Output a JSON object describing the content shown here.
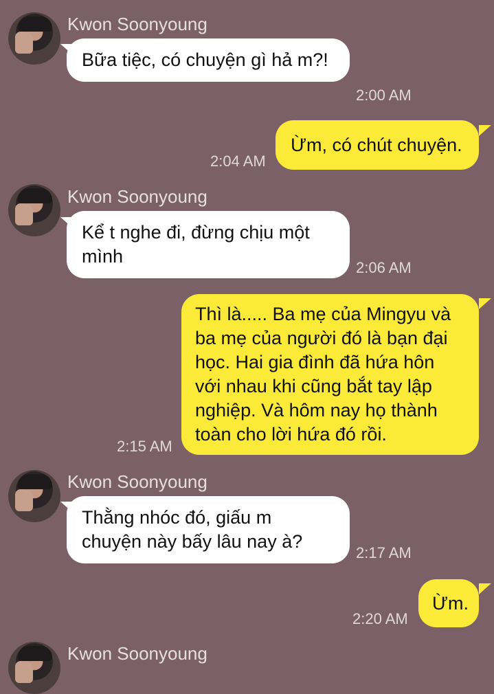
{
  "messages": [
    {
      "sender": "Kwon Soonyoung",
      "text": "Bữa tiệc, có chuyện gì hả m?!",
      "time": "2:00 AM"
    },
    {
      "text": "Ừm, có chút chuyện.",
      "time": "2:04 AM"
    },
    {
      "sender": "Kwon Soonyoung",
      "text": "Kể t nghe đi, đừng chịu một mình",
      "time": "2:06 AM"
    },
    {
      "text": "Thì là..... Ba mẹ của Mingyu và ba mẹ của người đó là bạn đại học. Hai gia đình đã hứa hôn với nhau khi cũng bắt tay lập nghiệp. Và hôm nay họ thành toàn cho lời hứa đó rồi.",
      "time": "2:15 AM"
    },
    {
      "sender": "Kwon Soonyoung",
      "text": "Thằng nhóc đó, giấu m chuyện này bấy lâu nay à?",
      "time": "2:17 AM"
    },
    {
      "text": "Ừm.",
      "time": "2:20 AM"
    },
    {
      "sender": "Kwon Soonyoung"
    }
  ],
  "colors": {
    "background": "#7b6068",
    "incoming": "#ffffff",
    "outgoing": "#fbea38"
  }
}
